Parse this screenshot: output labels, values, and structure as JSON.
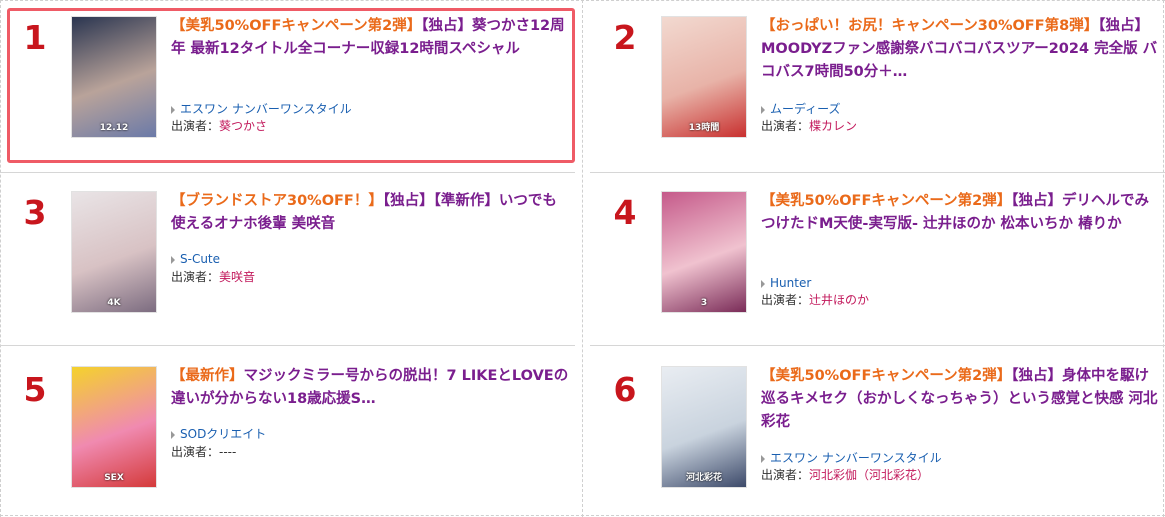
{
  "items": [
    {
      "rank": "1",
      "title_parts": [
        {
          "t": "【美乳50%OFFキャンペーン第2弾】",
          "tag": true
        },
        {
          "t": "【独占】葵つかさ12周年 最新12タイトル全コーナー収録12時間スペシャル",
          "tag": false
        }
      ],
      "maker": "エスワン ナンバーワンスタイル",
      "actor_label": "出演者：",
      "actor": "葵つかさ",
      "thumb_label": "12.12",
      "thumb_colors": [
        "#2a3550",
        "#b9a39a",
        "#6b7aa8"
      ]
    },
    {
      "rank": "2",
      "title_parts": [
        {
          "t": "【おっぱい！お尻！キャンペーン30%OFF第8弾】",
          "tag": true
        },
        {
          "t": "【独占】MOODYZファン感謝祭バコバコバスツアー2024 完全版 バコバス7時間50分＋…",
          "tag": false
        }
      ],
      "maker": "ムーディーズ",
      "actor_label": "出演者：",
      "actor": "楪カレン",
      "thumb_label": "13時間",
      "thumb_colors": [
        "#f2d9d0",
        "#e8b3a8",
        "#c8302f"
      ]
    },
    {
      "rank": "3",
      "title_parts": [
        {
          "t": "【ブランドストア30%OFF！】",
          "tag": true
        },
        {
          "t": "【独占】【準新作】いつでも使えるオナホ後輩 美咲音",
          "tag": false
        }
      ],
      "maker": "S-Cute",
      "actor_label": "出演者：",
      "actor": "美咲音",
      "thumb_label": "4K",
      "thumb_colors": [
        "#e9e4e6",
        "#d8c2c4",
        "#7c6c80"
      ]
    },
    {
      "rank": "4",
      "title_parts": [
        {
          "t": "【美乳50%OFFキャンペーン第2弾】",
          "tag": true
        },
        {
          "t": "【独占】デリヘルでみつけたドM天使-実写版- 辻井ほのか 松本いちか 椿りか",
          "tag": false
        }
      ],
      "maker": "Hunter",
      "actor_label": "出演者：",
      "actor": "辻井ほのか",
      "thumb_label": "3",
      "thumb_colors": [
        "#c55a8a",
        "#f0c2cf",
        "#7a2c58"
      ]
    },
    {
      "rank": "5",
      "title_parts": [
        {
          "t": "【最新作】",
          "tag": true
        },
        {
          "t": "マジックミラー号からの脱出！7 LIKEとLOVEの違いが分からない18歳応援S…",
          "tag": false
        }
      ],
      "maker": "SODクリエイト",
      "actor_label": "出演者：",
      "actor": "----",
      "thumb_label": "SEX",
      "thumb_colors": [
        "#f4d22c",
        "#f08ab0",
        "#d43a3a"
      ]
    },
    {
      "rank": "6",
      "title_parts": [
        {
          "t": "【美乳50%OFFキャンペーン第2弾】",
          "tag": true
        },
        {
          "t": "【独占】身体中を駆け巡るキメセク（おかしくなっちゃう）という感覚と快感 河北彩花",
          "tag": false
        }
      ],
      "maker": "エスワン ナンバーワンスタイル",
      "actor_label": "出演者：",
      "actor": "河北彩伽（河北彩花）",
      "thumb_label": "河北彩花",
      "thumb_colors": [
        "#e9edf2",
        "#c9d3de",
        "#3d4a6a"
      ]
    }
  ]
}
